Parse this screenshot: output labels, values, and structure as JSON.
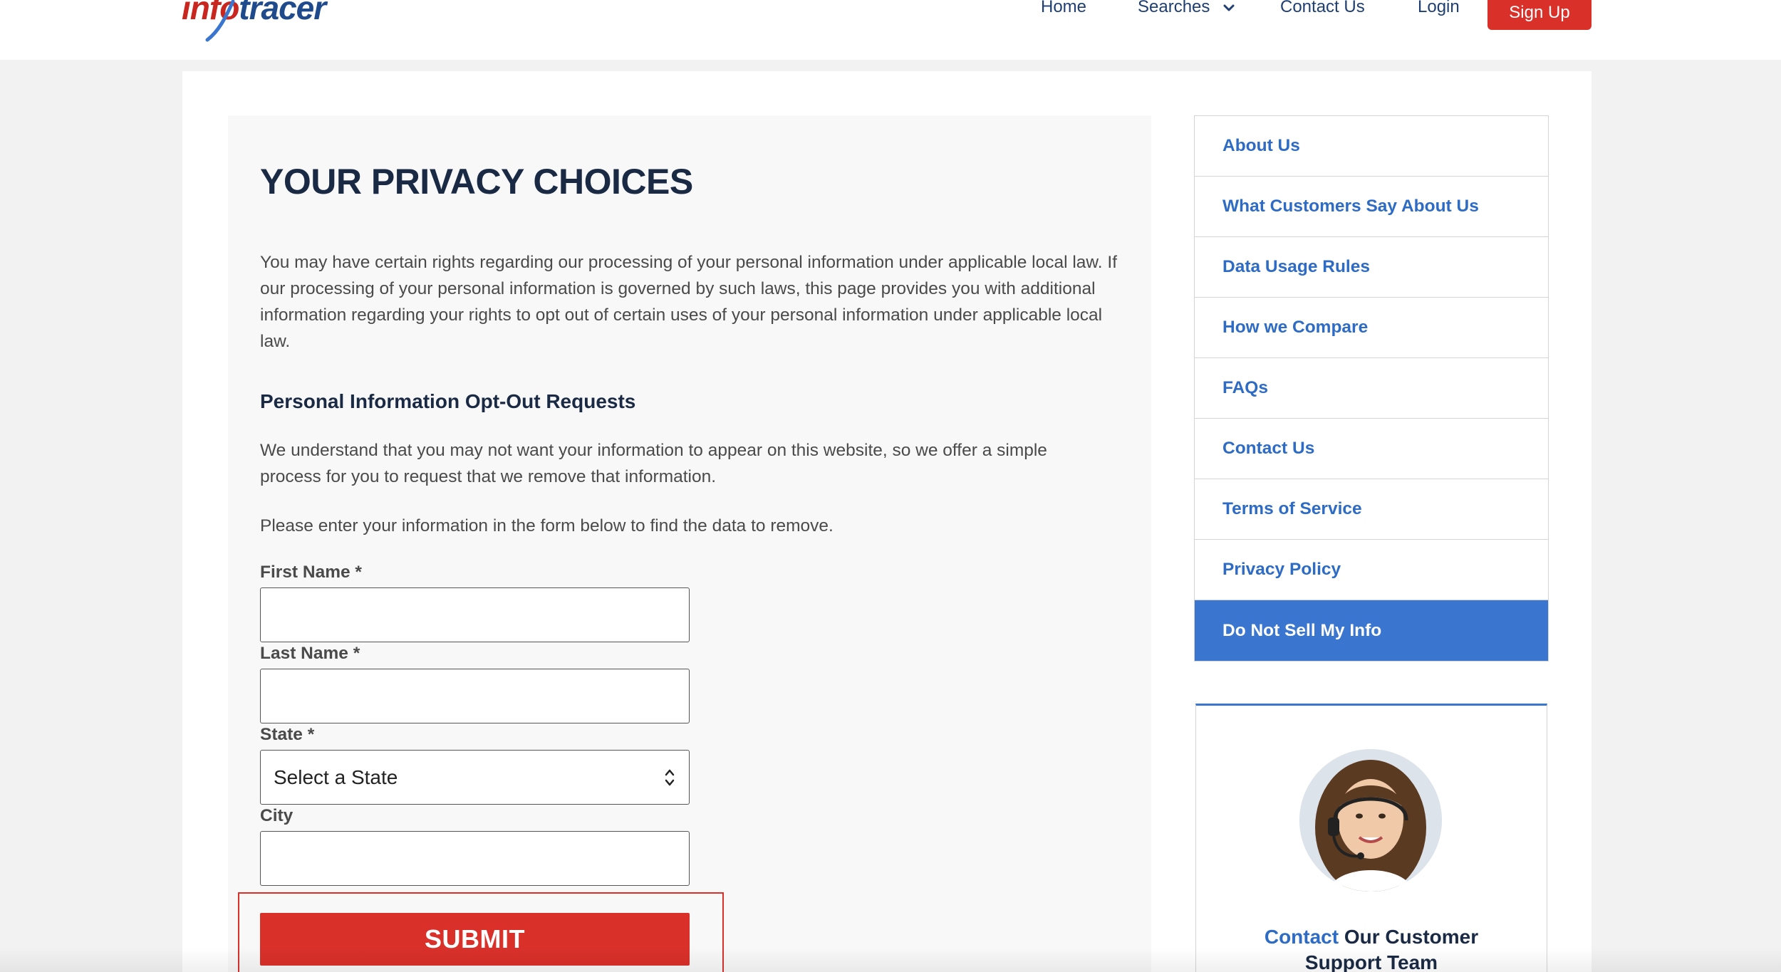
{
  "header": {
    "logo": {
      "part1": "info",
      "part2": "tracer"
    },
    "nav": {
      "home": "Home",
      "searches": "Searches",
      "contact": "Contact Us",
      "login": "Login",
      "signup": "Sign Up"
    }
  },
  "main": {
    "title": "YOUR PRIVACY CHOICES",
    "intro": "You may have certain rights regarding our processing of your personal information under applicable local law. If our processing of your personal information is governed by such laws, this page provides you with additional information regarding your rights to opt out of certain uses of your personal information under applicable local law.",
    "subheading": "Personal Information Opt-Out Requests",
    "para2": "We understand that you may not want your information to appear on this website, so we offer a simple process for you to request that we remove that information.",
    "para3": "Please enter your information in the form below to find the data to remove.",
    "form": {
      "first_name_label": "First Name *",
      "first_name_value": "",
      "last_name_label": "Last Name *",
      "last_name_value": "",
      "state_label": "State *",
      "state_selected": "Select a State",
      "city_label": "City",
      "city_value": "",
      "submit_label": "SUBMIT"
    }
  },
  "sidebar": {
    "items": [
      {
        "label": "About Us"
      },
      {
        "label": "What Customers Say About Us"
      },
      {
        "label": "Data Usage Rules"
      },
      {
        "label": "How we Compare"
      },
      {
        "label": "FAQs"
      },
      {
        "label": "Contact Us"
      },
      {
        "label": "Terms of Service"
      },
      {
        "label": "Privacy Policy"
      },
      {
        "label": "Do Not Sell My Info"
      }
    ],
    "active_index": 8
  },
  "support": {
    "highlight": "Contact",
    "text_line1_rest": " Our Customer",
    "text_line2": "Support Team"
  },
  "colors": {
    "brand_red": "#d9302a",
    "brand_blue": "#3a76cf",
    "link_blue": "#2d6bc4",
    "heading_navy": "#1a2a44"
  }
}
